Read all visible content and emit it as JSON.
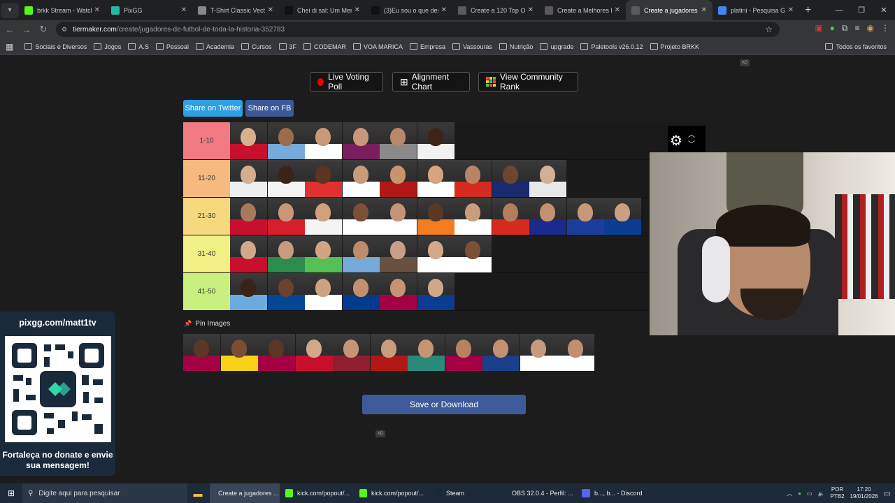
{
  "browser": {
    "tabs": [
      {
        "label": "brkk Stream - Watch",
        "color": "#53fc18"
      },
      {
        "label": "PixGG",
        "color": "#27b9a5"
      },
      {
        "label": "T-Shirt Classic Vectra",
        "color": "#888888"
      },
      {
        "label": "Chei di sal: Um Meme",
        "color": "#111111"
      },
      {
        "label": "(3)Eu sou o que desn",
        "color": "#111111"
      },
      {
        "label": "Create a 120 Top One",
        "color": "#5a5a5a"
      },
      {
        "label": "Create a Melhores lu",
        "color": "#5a5a5a"
      },
      {
        "label": "Create a jugadores de",
        "color": "#5a5a5a"
      },
      {
        "label": "platini - Pesquisa Go",
        "color": "#4285f4"
      }
    ],
    "address": {
      "host": "tiermaker.com",
      "path": "/create/jugadores-de-futbol-de-toda-la-historia-352783"
    },
    "bookmarks": [
      "Sociais e Diversos",
      "Jogos",
      "A.S",
      "Pessoal",
      "Academia",
      "Cursos",
      "3F",
      "CODEMAR",
      "VOA MARICA",
      "Empresa",
      "Vassouras",
      "Nutrição",
      "upgrade",
      "Paletools v26.0.12",
      "Projeto BRKK"
    ],
    "all_favorites": "Todos os favoritos"
  },
  "page": {
    "ad_label": "AD",
    "buttons": {
      "live_voting": "Live Voting Poll",
      "alignment": "Alignment Chart",
      "community": "View Community Rank"
    },
    "share_twitter": "Share on Twitter",
    "share_fb": "Share on FB",
    "pin_images": "Pin Images",
    "save_download": "Save or Download"
  },
  "tiers": [
    {
      "label": "1-10",
      "color": "#f27a82",
      "items": [
        [
          "#c8102e",
          "#d8b08c"
        ],
        [
          "#75aadb",
          "#9b6b4a"
        ],
        [
          "#ffffff",
          "#c89a78"
        ],
        [
          "#7a1f5e",
          "#c9977a"
        ],
        [
          "#8a8a8a",
          "#b98769"
        ],
        [
          "#f2f2f2",
          "#3d2416"
        ]
      ]
    },
    {
      "label": "11-20",
      "color": "#f6b97f",
      "items": [
        [
          "#eeeeee",
          "#d5ad8f"
        ],
        [
          "#f4f4f4",
          "#3a2418"
        ],
        [
          "#e03030",
          "#5a3524"
        ],
        [
          "#ffffff",
          "#c89c7a"
        ],
        [
          "#b01818",
          "#c79470"
        ],
        [
          "#ffffff",
          "#d6a47e"
        ],
        [
          "#d52b1e",
          "#b98364"
        ],
        [
          "#1a2a6c",
          "#6c4632"
        ],
        [
          "#e8e8e8",
          "#d0b098"
        ]
      ]
    },
    {
      "label": "21-30",
      "color": "#f6d87f",
      "items": [
        [
          "#c8102e",
          "#a87a5c"
        ],
        [
          "#d81e2c",
          "#c99778"
        ],
        [
          "#f4f4f4",
          "#d2a07c"
        ],
        [
          "#ffffff",
          "#7c5038"
        ],
        [
          "#ffffff",
          "#c49478"
        ],
        [
          "#f47d20",
          "#5a3828"
        ],
        [
          "#ffffff",
          "#c89c7c"
        ],
        [
          "#d52b1e",
          "#b37c5c"
        ],
        [
          "#1a2a8c",
          "#c39070"
        ],
        [
          "#1d3d9c",
          "#c69878"
        ],
        [
          "#0a3d91",
          "#caa080"
        ]
      ]
    },
    {
      "label": "31-40",
      "color": "#f0f084",
      "items": [
        [
          "#c8102e",
          "#d0a88a"
        ],
        [
          "#2b8c4e",
          "#c69c7e"
        ],
        [
          "#55c055",
          "#d1a484"
        ],
        [
          "#75aadb",
          "#bf8c6a"
        ],
        [
          "#6a5040",
          "#c8a088"
        ],
        [
          "#ffffff",
          "#d2a88a"
        ],
        [
          "#ffffff",
          "#7c5038"
        ]
      ]
    },
    {
      "label": "41-50",
      "color": "#c9f07f",
      "items": [
        [
          "#6cabdd",
          "#3a2418"
        ],
        [
          "#034694",
          "#6a4230"
        ],
        [
          "#ffffff",
          "#cca484"
        ],
        [
          "#003b8e",
          "#c29070"
        ],
        [
          "#a50044",
          "#c49474"
        ],
        [
          "#0a3d91",
          "#d0a888"
        ]
      ]
    }
  ],
  "pool": [
    [
      "#a50044",
      "#5a3726"
    ],
    [
      "#f7d117",
      "#7a4e34"
    ],
    [
      "#a50044",
      "#5a3726"
    ],
    [
      "#c8102e",
      "#d2a88a"
    ],
    [
      "#8e1f2f",
      "#c59676"
    ],
    [
      "#b01818",
      "#c89c7c"
    ],
    [
      "#2a8a7a",
      "#c49474"
    ],
    [
      "#a50044",
      "#b58262"
    ],
    [
      "#1b3f8b",
      "#c39070"
    ],
    [
      "#ffffff",
      "#c69a7c"
    ],
    [
      "#ffffff",
      "#c09070"
    ]
  ],
  "promo": {
    "url": "pixgg.com/matt1tv",
    "message": "Fortaleça no donate e envie sua mensagem!"
  },
  "taskbar": {
    "search": "Digite aqui para pesquisar",
    "items": [
      {
        "label": "Create a jugadores ...",
        "color": "#4285f4"
      },
      {
        "label": "kick.com/popout/...",
        "color": "#53fc18"
      },
      {
        "label": "kick.com/popout/...",
        "color": "#53fc18"
      },
      {
        "label": "Steam",
        "color": "#1b2838"
      },
      {
        "label": "OBS 32.0.4 - Perfil: ...",
        "color": "#302e31"
      },
      {
        "label": "b..., b... - Discord",
        "color": "#5865f2"
      }
    ],
    "lang": "POR",
    "kb": "PTB2",
    "time": "17:20",
    "date": "19/01/2026"
  }
}
